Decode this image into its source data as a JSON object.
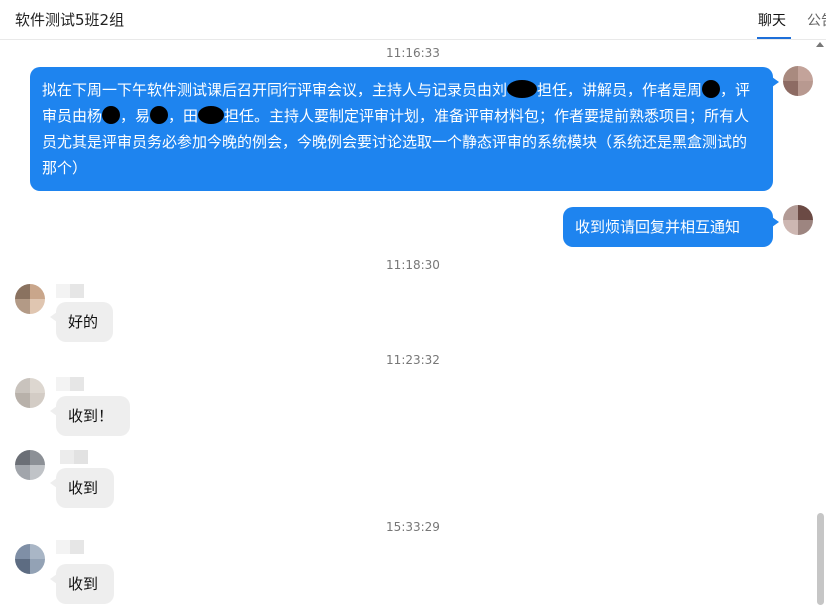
{
  "header": {
    "group_name": "软件测试5班2组",
    "tabs": [
      {
        "label": "聊天",
        "active": true
      },
      {
        "label": "公告",
        "active": false
      }
    ]
  },
  "colors": {
    "accent": "#1e6fd9",
    "outgoing_bubble": "#1e84ef",
    "incoming_bubble": "#eeeeee"
  },
  "messages": [
    {
      "time": "11:16:33",
      "direction": "outgoing",
      "text_parts": [
        "拟在下周一下午软件测试课后召开同行评审会议，主持人与记录员由刘",
        "担任，讲解员，作者是周",
        "，评审员由杨",
        "，易",
        "，田",
        "担任。主持人要制定评审计划，准备评审材料包；作者要提前熟悉项目；所有人员尤其是评审员务必参加今晚的例会，今晚例会要讨论选取一个静态评审的系统模块（系统还是黑盒测试的那个）"
      ]
    },
    {
      "direction": "outgoing",
      "text": "收到烦请回复并相互通知"
    },
    {
      "time": "11:18:30",
      "direction": "incoming",
      "text": "好的"
    },
    {
      "time": "11:23:32",
      "direction": "incoming",
      "text": "收到！"
    },
    {
      "direction": "incoming",
      "text": "收到"
    },
    {
      "time": "15:33:29",
      "direction": "incoming",
      "text": "收到"
    }
  ]
}
